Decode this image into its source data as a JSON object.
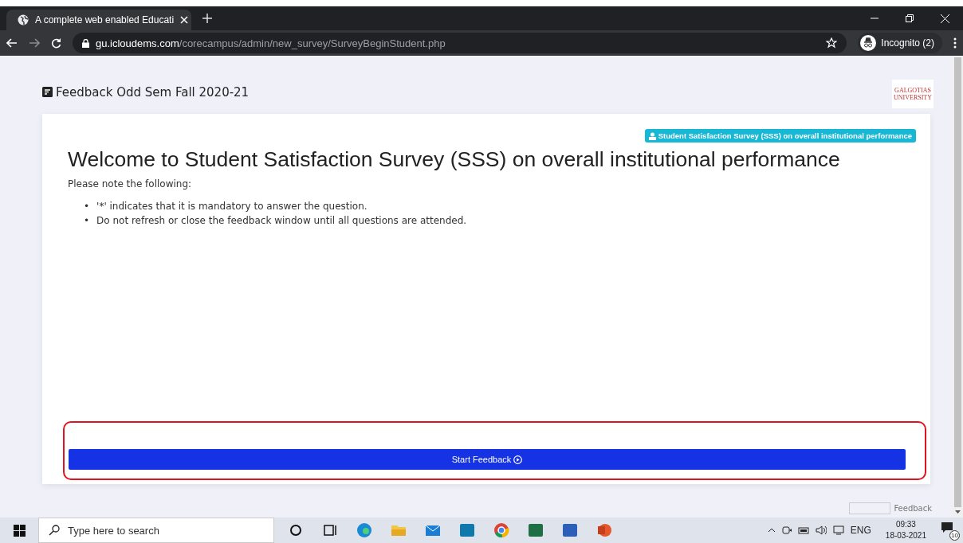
{
  "browser": {
    "tab_title": "A complete web enabled Educati",
    "url": {
      "host": "gu.icloudems.com",
      "path": "/corecampus/admin/new_survey/SurveyBeginStudent.php"
    },
    "profile": "Incognito (2)"
  },
  "page": {
    "heading": "Feedback Odd Sem Fall 2020-21",
    "logo": [
      "GALGOTIAS",
      "UNIVERSITY"
    ],
    "badge": "Student Satisfaction Survey (SSS) on overall institutional performance",
    "title": "Welcome to Student Satisfaction Survey (SSS) on overall institutional performance",
    "intro": "Please note the following:",
    "notes": [
      {
        "bullet": "•",
        "text": "'*' indicates that it is mandatory to answer the question."
      },
      {
        "bullet": "•",
        "text": "Do not refresh or close the feedback window until all questions are attended."
      }
    ],
    "start_button": "Start Feedback",
    "feedback_link": "Feedback"
  },
  "taskbar": {
    "search_placeholder": "Type here to search",
    "language": "ENG",
    "time": "09:33",
    "date": "18-03-2021",
    "notifications": "10"
  }
}
